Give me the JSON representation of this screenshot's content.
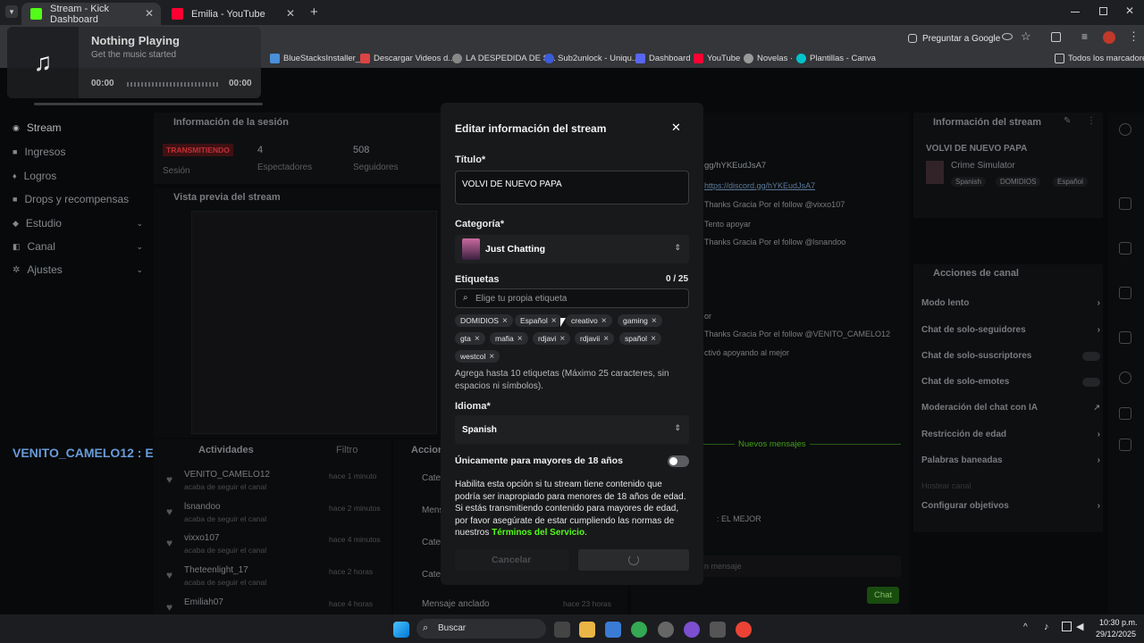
{
  "browser": {
    "tabs": [
      {
        "label": "Stream - Kick Dashboard",
        "active": true
      },
      {
        "label": "Emilia - YouTube",
        "active": false
      }
    ],
    "new_tab": "+",
    "google_button": "Preguntar a Google",
    "bookmarks": [
      "BlueStacksInstaller_...",
      "Descargar Videos d...",
      "LA DESPEDIDA DE S...",
      "Sub2unlock - Uniqu...",
      "Dashboard",
      "YouTube",
      "Novelas ·",
      "Plantillas - Canva"
    ],
    "bookmarks_folder": "Todos los marcadores"
  },
  "music_widget": {
    "title": "Nothing Playing",
    "subtitle": "Get the music started",
    "time_start": "00:00",
    "time_end": "00:00"
  },
  "sidebar": {
    "items": [
      {
        "label": "Stream"
      },
      {
        "label": "Ingresos"
      },
      {
        "label": "Logros"
      },
      {
        "label": "Drops y recompensas"
      },
      {
        "label": "Estudio"
      },
      {
        "label": "Canal"
      },
      {
        "label": "Ajustes"
      }
    ]
  },
  "session": {
    "title": "Información de la sesión",
    "status": "TRANSMITIENDO",
    "status_label": "Sesión",
    "viewers": "4",
    "viewers_label": "Espectadores",
    "followers": "508",
    "followers_label": "Seguidores"
  },
  "preview": {
    "title": "Vista previa del stream",
    "overlay_text": "VENITO_CAMELO12 : EL MEJOR"
  },
  "activity": {
    "title": "Actividades",
    "filter": "Filtro",
    "items": [
      {
        "user": "VENITO_CAMELO12",
        "action": "acaba de seguir el canal",
        "time": "hace 1 minuto"
      },
      {
        "user": "lsnandoo",
        "action": "acaba de seguir el canal",
        "time": "hace 2 minutos"
      },
      {
        "user": "vixxo107",
        "action": "acaba de seguir el canal",
        "time": "hace 4 minutos"
      },
      {
        "user": "Theteenlight_17",
        "action": "acaba de seguir el canal",
        "time": "hace 2 horas"
      },
      {
        "user": "Emiliah07",
        "action": "",
        "time": "hace 4 horas"
      }
    ]
  },
  "actions_panel": {
    "title": "Acciones",
    "items": [
      "Cate",
      "Mens",
      "Cate",
      "Cate"
    ],
    "anchored": "Mensaje anclado",
    "anchored_time": "hace 23 horas"
  },
  "chat": {
    "lines": [
      "gg/hYKEudJsA7",
      "https://discord.gg/hYKEudJsA7",
      "Thanks Gracia Por el follow @vixxo107",
      "Tento apoyar",
      "Thanks Gracia Por el follow @lsnandoo",
      "or",
      "Thanks Gracia Por el follow @VENITO_CAMELO12",
      "ctivó apoyando al mejor"
    ],
    "new_messages": "Nuevos mensajes",
    "last_line": ": EL MEJOR",
    "input_placeholder": "n mensaje",
    "send": "Chat"
  },
  "stream_info": {
    "title": "Información del stream",
    "stream_title": "VOLVI DE NUEVO PAPA",
    "category": "Crime Simulator",
    "tags": [
      "Spanish",
      "DOMIDIOS",
      "Español"
    ]
  },
  "channel_actions": {
    "title": "Acciones de canal",
    "items": [
      {
        "label": "Modo lento",
        "control": "chevron"
      },
      {
        "label": "Chat de solo-seguidores",
        "control": "chevron"
      },
      {
        "label": "Chat de solo-suscriptores",
        "control": "toggle"
      },
      {
        "label": "Chat de solo-emotes",
        "control": "toggle"
      },
      {
        "label": "Moderación del chat con IA",
        "control": "chart"
      },
      {
        "label": "Restricción de edad",
        "control": "chevron"
      },
      {
        "label": "Palabras baneadas",
        "control": "chevron"
      },
      {
        "label": "Hostear canal",
        "control": "none"
      },
      {
        "label": "Configurar objetivos",
        "control": "chevron"
      }
    ]
  },
  "modal": {
    "title": "Editar información del stream",
    "title_label": "Título*",
    "title_value": "VOLVI DE NUEVO PAPA",
    "category_label": "Categoría*",
    "category_value": "Just Chatting",
    "tags_label": "Etiquetas",
    "tags_count": "0 / 25",
    "tag_placeholder": "Elige tu propia etiqueta",
    "tags": [
      "DOMIDIOS",
      "Español",
      "creativo",
      "gaming",
      "gta",
      "mafia",
      "rdjavi",
      "rdjavii",
      "spañol",
      "westcol"
    ],
    "tags_help": "Agrega hasta 10 etiquetas (Máximo 25 caracteres, sin espacios ni símbolos).",
    "language_label": "Idioma*",
    "language_value": "Spanish",
    "adult_label": "Únicamente para mayores de 18 años",
    "adult_enabled": false,
    "adult_help": "Habilita esta opción si tu stream tiene contenido que podría ser inapropiado para menores de 18 años de edad. Si estás transmitiendo contenido para mayores de edad, por favor asegúrate de estar cumpliendo las normas de nuestros",
    "tos_link": "Términos del Servicio",
    "tos_suffix": ".",
    "cancel": "Cancelar"
  },
  "taskbar": {
    "search": "Buscar",
    "time": "10:30 p.m.",
    "date": "29/12/2025"
  },
  "colors": {
    "accent": "#53fc18",
    "live": "#e2383e",
    "modal_bg": "#18191b",
    "page_bg": "#0a0b0c"
  }
}
